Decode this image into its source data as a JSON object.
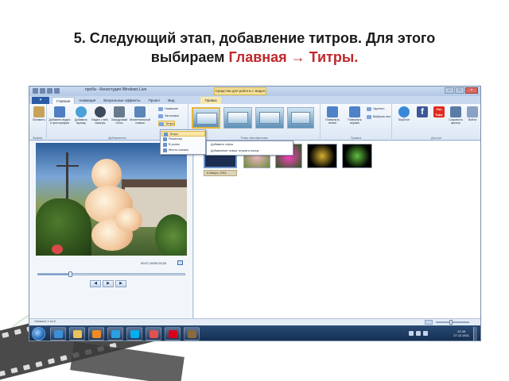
{
  "slide": {
    "title_line1": "5. Следующий этап, добавление титров. Для этого",
    "title_line2_prefix": "выбираем ",
    "title_line2_accent": "Главная → Титры."
  },
  "colors": {
    "accent": "#c0282c",
    "file_tab": "#2b5aa6",
    "taskbar": "#1d3a60",
    "highlight": "#fbe6a6"
  },
  "app": {
    "title": "проба - Киностудия Windows Live",
    "context_tab_header": "Средства для работы с видео",
    "window_buttons": [
      "–",
      "□",
      "×"
    ]
  },
  "tabs": {
    "file": "▾",
    "items": [
      "Главная",
      "Анимация",
      "Визуальные эффекты",
      "Проект",
      "Вид"
    ],
    "context": "Правка"
  },
  "ribbon": {
    "groups": {
      "clipboard": "Буфер",
      "add": "Добавление",
      "themes": "Темы автофильма",
      "editing": "Правка",
      "share": "Доступ"
    },
    "buttons": {
      "paste": "Вставить",
      "add_video": "Добавить видео и фотографии",
      "add_music": "Добавить музыку",
      "webcam": "Видео с веб-камеры",
      "narration": "Закадровый голос",
      "snapshot": "Моментальный снимок",
      "rotate_left": "Повернуть влево",
      "rotate_right": "Повернуть вправо",
      "select_all": "Выбрать все",
      "youtube": "YouTube",
      "save_movie": "Сохранить фильм",
      "sign_in": "Войти"
    },
    "small": {
      "title_name": "Название",
      "caption": "Заголовок",
      "credits": "Титры",
      "delete": "Удалить"
    },
    "share_icons": [
      "SkyDrive",
      "f",
      "You Tube"
    ]
  },
  "credits_menu": {
    "items": [
      "Титры",
      "Режиссер",
      "В ролях",
      "Место съемок"
    ],
    "highlighted_index": 0
  },
  "tooltip": {
    "lines": [
      "Добавить титры",
      "Добавление новых титров в конце"
    ]
  },
  "preview": {
    "timecode": "00:07,26/00:25,00",
    "progress": 0.22,
    "controls": [
      "◀",
      "▶",
      "▶"
    ]
  },
  "storyboard": {
    "caption_chip": "A Август, 2011",
    "clips": [
      {
        "name": "flower-pink",
        "color": "#c86090"
      },
      {
        "name": "flower-magenta",
        "color": "#d01890"
      },
      {
        "name": "sparkle-gold",
        "color": "#c8a020"
      },
      {
        "name": "sparkle-green",
        "color": "#50a030"
      }
    ]
  },
  "status": {
    "text": "Элемент 2 из 5",
    "zoom": 0.45
  },
  "taskbar": {
    "clock_time": "22:45",
    "clock_date": "27.12.2011",
    "apps": [
      {
        "name": "ie-icon",
        "color": "#3b8fd9"
      },
      {
        "name": "explorer-icon",
        "color": "#e8c35a"
      },
      {
        "name": "media-player-icon",
        "color": "#f08a24"
      },
      {
        "name": "photo-gallery-icon",
        "color": "#2aa0e0"
      },
      {
        "name": "skype-icon",
        "color": "#00aff0"
      },
      {
        "name": "paint-icon",
        "color": "#e05050"
      },
      {
        "name": "opera-icon",
        "color": "#d8001a"
      },
      {
        "name": "movie-maker-icon",
        "color": "#8a6a40"
      }
    ]
  }
}
